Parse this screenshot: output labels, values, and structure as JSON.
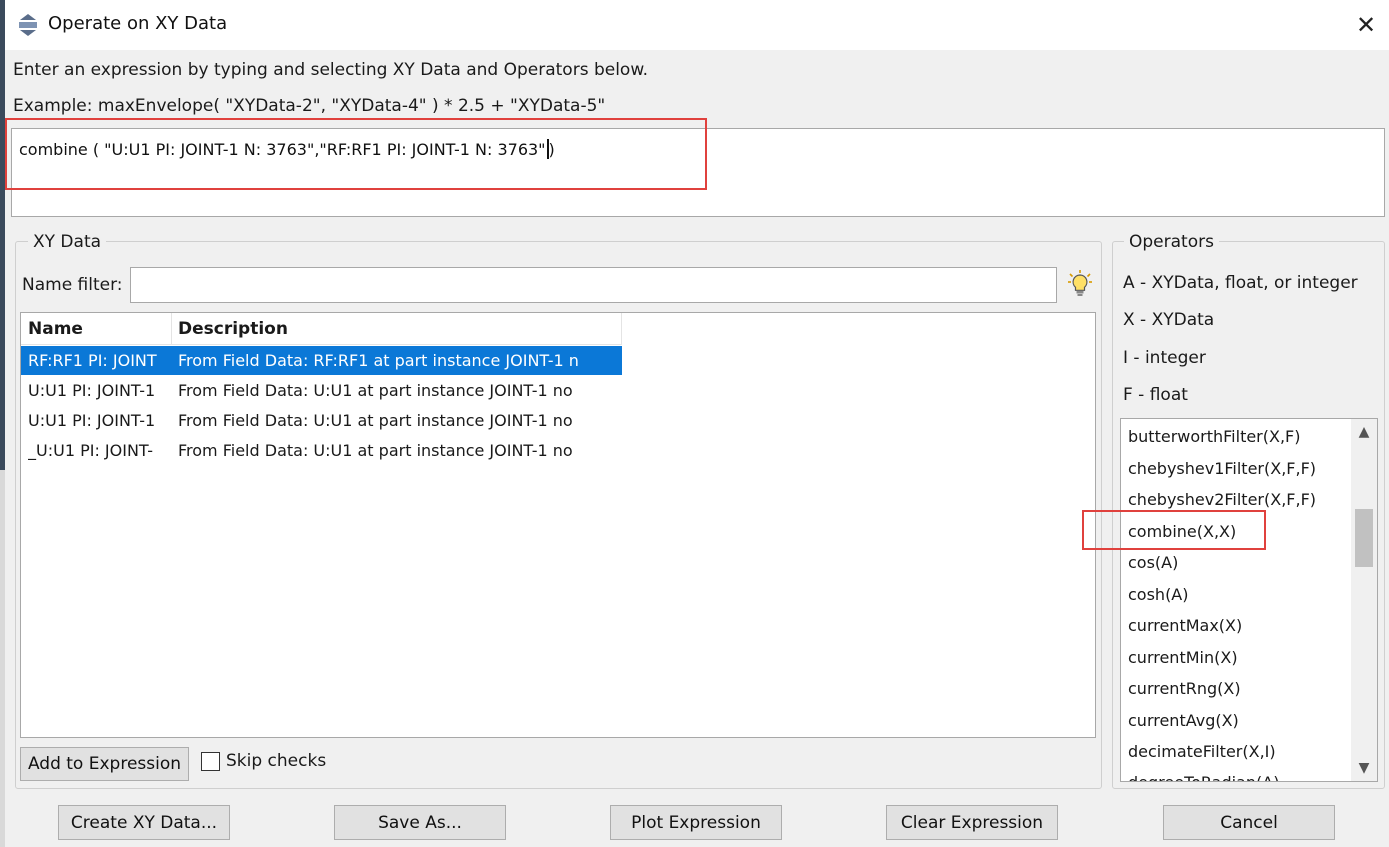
{
  "window": {
    "title": "Operate on XY Data",
    "close_label": "✕"
  },
  "instructions": "Enter an expression by typing and selecting XY Data and Operators below.",
  "example": "Example: maxEnvelope( \"XYData-2\", \"XYData-4\" ) * 2.5 + \"XYData-5\"",
  "expression": {
    "before_cursor": "combine ( \"U:U1 PI: JOINT-1 N: 3763\",\"RF:RF1 PI: JOINT-1 N: 3763\"",
    "after_cursor": ")"
  },
  "xy_data": {
    "group_label": "XY Data",
    "name_filter_label": "Name filter:",
    "name_filter_value": "",
    "columns": [
      "Name",
      "Description"
    ],
    "rows": [
      {
        "name": "RF:RF1 PI: JOINT",
        "description": "From Field Data: RF:RF1  at part instance JOINT-1 n",
        "selected": true
      },
      {
        "name": "U:U1 PI: JOINT-1",
        "description": "From Field Data: U:U1  at part instance JOINT-1 no",
        "selected": false
      },
      {
        "name": "U:U1 PI: JOINT-1",
        "description": "From Field Data: U:U1  at part instance JOINT-1 no",
        "selected": false
      },
      {
        "name": "_U:U1 PI: JOINT-",
        "description": "From Field Data: U:U1  at part instance JOINT-1 no",
        "selected": false
      }
    ],
    "add_button": "Add to Expression",
    "skip_checks_label": "Skip checks"
  },
  "operators": {
    "group_label": "Operators",
    "legend": [
      "A - XYData, float, or integer",
      "X - XYData",
      "I - integer",
      "F - float"
    ],
    "items": [
      "butterworthFilter(X,F)",
      "chebyshev1Filter(X,F,F)",
      "chebyshev2Filter(X,F,F)",
      "combine(X,X)",
      "cos(A)",
      "cosh(A)",
      "currentMax(X)",
      "currentMin(X)",
      "currentRng(X)",
      "currentAvg(X)",
      "decimateFilter(X,I)",
      "degreeToRadian(A)"
    ]
  },
  "buttons": {
    "create": "Create XY Data...",
    "save_as": "Save As...",
    "plot": "Plot Expression",
    "clear": "Clear Expression",
    "cancel": "Cancel"
  },
  "colors": {
    "selection": "#0b78d7",
    "highlight_box": "#e0413d"
  }
}
